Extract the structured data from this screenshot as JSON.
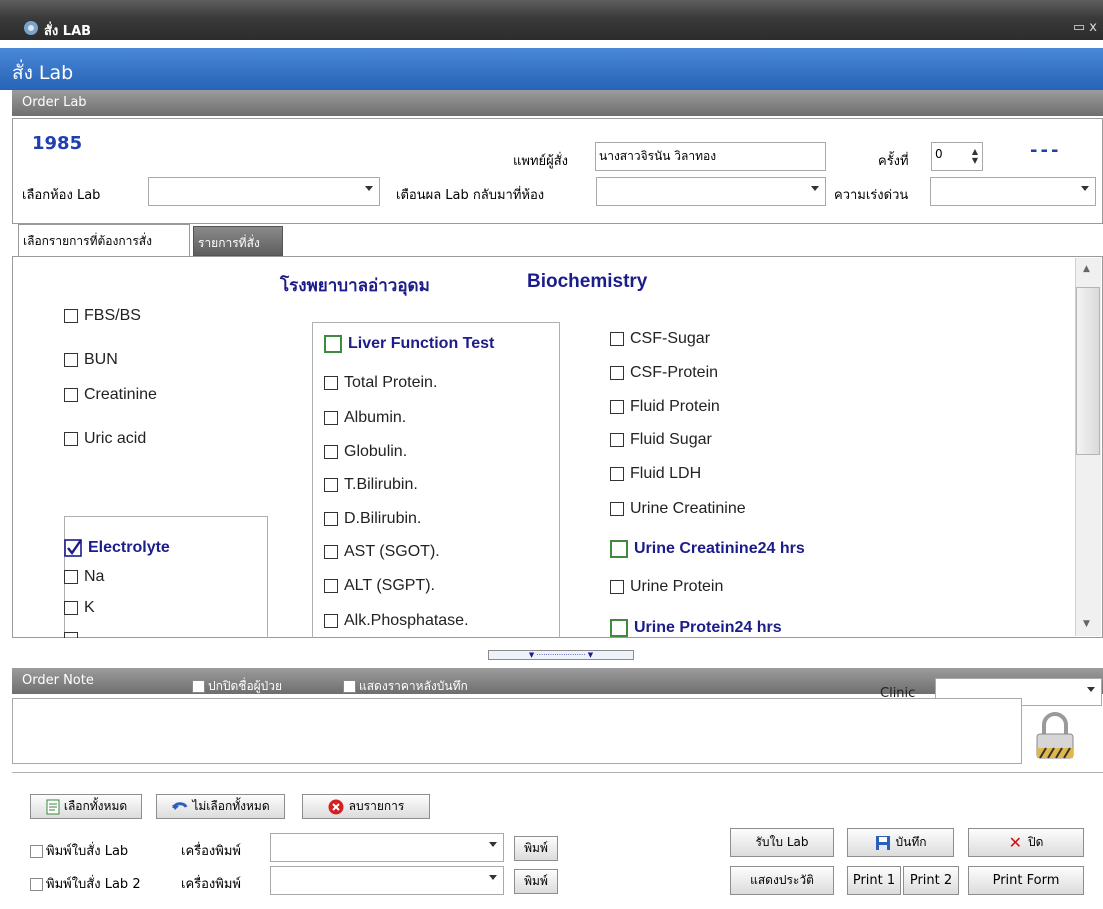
{
  "window": {
    "title": "สั่ง LAB",
    "controls": "▭ x"
  },
  "header": {
    "title": "สั่ง Lab"
  },
  "section": {
    "order_lab": "Order Lab"
  },
  "form": {
    "order_number": "1985",
    "doctor_label": "แพทย์ผู้สั่ง",
    "doctor_value": "นางสาวจิรนัน วิลาทอง",
    "times_label": "ครั้งที่",
    "times_value": "0",
    "status_dashes": "---",
    "lab_room_label": "เลือกห้อง Lab",
    "lab_room_value": "",
    "notify_label": "เตือนผล Lab กลับมาที่ห้อง",
    "notify_value": "",
    "urgency_label": "ความเร่งด่วน",
    "urgency_value": ""
  },
  "tabs": [
    {
      "label": "เลือกรายการที่ต้องการสั่ง",
      "active": true
    },
    {
      "label": "รายการที่สั่ง",
      "active": false
    }
  ],
  "lab_sheet": {
    "hospital": "โรงพยาบาลอ่าวอุดม",
    "department": "Biochemistry",
    "col1": [
      {
        "label": "FBS/BS",
        "checked": false
      },
      {
        "label": "BUN",
        "checked": false
      },
      {
        "label": "Creatinine",
        "checked": false
      },
      {
        "label": "Uric acid",
        "checked": false
      }
    ],
    "electrolyte": {
      "header": "Electrolyte",
      "checked": true,
      "items": [
        {
          "label": "Na",
          "checked": false
        },
        {
          "label": "K",
          "checked": false
        }
      ]
    },
    "liver": {
      "header": "Liver Function Test",
      "items": [
        {
          "label": "Total Protein.",
          "checked": false
        },
        {
          "label": "Albumin.",
          "checked": false
        },
        {
          "label": "Globulin.",
          "checked": false
        },
        {
          "label": "T.Bilirubin.",
          "checked": false
        },
        {
          "label": "D.Bilirubin.",
          "checked": false
        },
        {
          "label": "AST (SGOT).",
          "checked": false
        },
        {
          "label": "ALT (SGPT).",
          "checked": false
        },
        {
          "label": "Alk.Phosphatase.",
          "checked": false
        }
      ]
    },
    "col3": [
      {
        "label": "CSF-Sugar",
        "checked": false
      },
      {
        "label": "CSF-Protein",
        "checked": false
      },
      {
        "label": "Fluid Protein",
        "checked": false
      },
      {
        "label": "Fluid Sugar",
        "checked": false
      },
      {
        "label": "Fluid  LDH",
        "checked": false
      },
      {
        "label": "Urine Creatinine",
        "checked": false
      }
    ],
    "urine_creat_24": "Urine Creatinine24 hrs",
    "urine_protein": "Urine Protein",
    "urine_protein_24": "Urine Protein24 hrs"
  },
  "order_note": {
    "title": "Order Note",
    "hide_name": "ปกปิดชื่อผู้ป่วย",
    "show_price": "แสดงราคาหลังบันทึก",
    "clinic_label": "Clinic",
    "clinic_value": "",
    "note_text": ""
  },
  "footer": {
    "select_all": "เลือกทั้งหมด",
    "deselect_all": "ไม่เลือกทั้งหมด",
    "delete_items": "ลบรายการ",
    "print_lab": "พิมพ์ใบสั่ง Lab",
    "print_lab2": "พิมพ์ใบสั่ง Lab 2",
    "printer_label": "เครื่องพิมพ์",
    "printer1_value": "",
    "printer2_value": "",
    "print_btn": "พิมพ์",
    "receive_lab": "รับใบ Lab",
    "save": "บันทึก",
    "close": "ปิด",
    "show_history": "แสดงประวัติ",
    "print1": "Print 1",
    "print2": "Print 2",
    "print_form": "Print Form"
  },
  "colors": {
    "header_blue": "#2c6bbf",
    "heading_navy": "#1c1c8a",
    "order_number": "#1f3fb0",
    "close_red": "#d01010"
  }
}
